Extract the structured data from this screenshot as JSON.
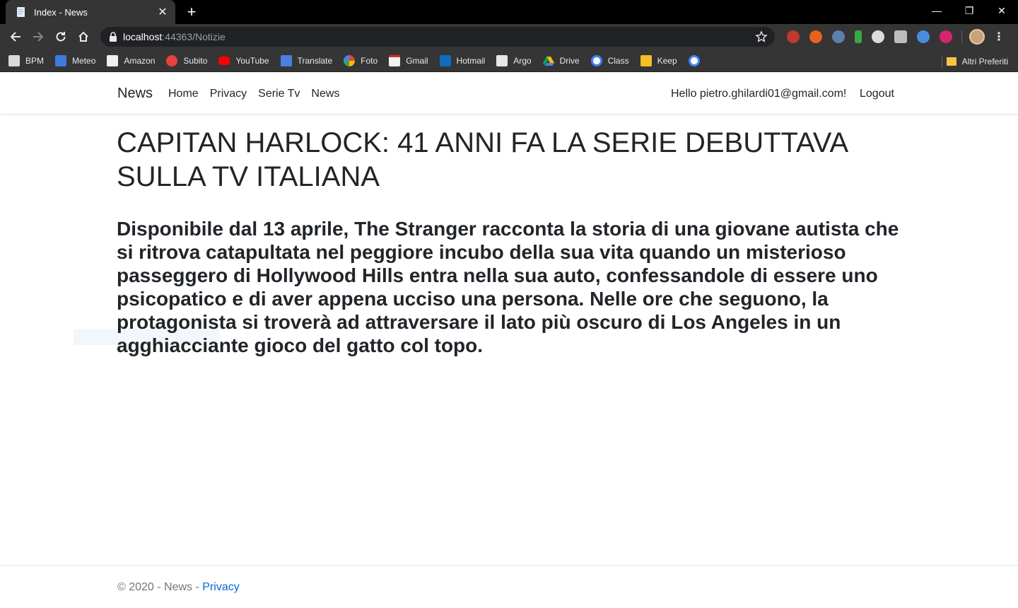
{
  "browser": {
    "tab_title": "Index - News",
    "url_host": "localhost",
    "url_rest": ":44363/Notizie",
    "bookmarks": [
      "BPM",
      "Meteo",
      "Amazon",
      "Subito",
      "YouTube",
      "Translate",
      "Foto",
      "Gmail",
      "Hotmail",
      "Argo",
      "Drive",
      "Class",
      "Keep"
    ],
    "other_bookmarks": "Altri Preferiti"
  },
  "nav": {
    "brand": "News",
    "links": [
      "Home",
      "Privacy",
      "Serie Tv",
      "News"
    ],
    "hello": "Hello pietro.ghilardi01@gmail.com!",
    "logout": "Logout"
  },
  "article": {
    "title": "CAPITAN HARLOCK: 41 ANNI FA LA SERIE DEBUTTAVA SULLA TV ITALIANA",
    "body": "Disponibile dal 13 aprile, The Stranger racconta la storia di una giovane autista che si ritrova catapultata nel peggiore incubo della sua vita quando un misterioso passeggero di Hollywood Hills entra nella sua auto, confessandole di essere uno psicopatico e di aver appena ucciso una persona. Nelle ore che seguono, la protagonista si troverà ad attraversare il lato più oscuro di Los Angeles in un agghiacciante gioco del gatto col topo."
  },
  "footer": {
    "copyright": "© 2020 - News - ",
    "privacy": "Privacy"
  },
  "colors": {
    "link": "#0366d6",
    "text": "#212529",
    "muted": "#6c757d",
    "chrome_bg": "#353535"
  }
}
